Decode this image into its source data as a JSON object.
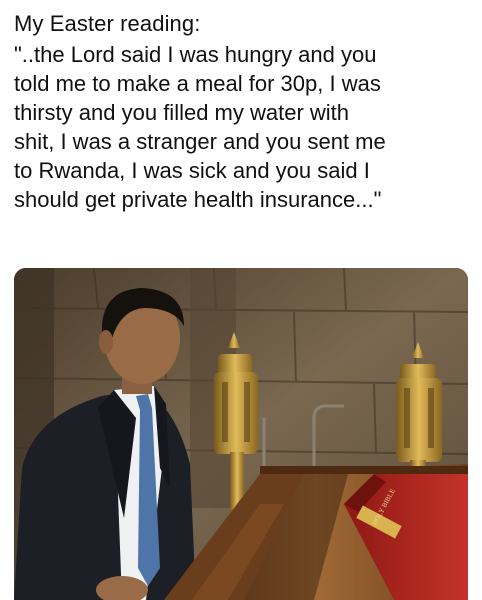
{
  "caption": {
    "title": "My Easter reading:",
    "quote_lines": [
      "\"..the Lord said I was hungry and you",
      "told me to make a meal for 30p, I was",
      "thirsty and you filled my water with",
      "shit, I was a stranger and you sent me",
      "to Rwanda, I was sick and you said I",
      "should get private health insurance...\""
    ]
  },
  "photo": {
    "subject": "man in dark suit speaking at church lectern",
    "book_spine_text": "HOLY BIBLE",
    "colors": {
      "stone_wall": "#6e5c45",
      "wood_lectern": "#8a5a2e",
      "brass": "#c9a046",
      "book_red": "#b3231d",
      "suit": "#1c1f26",
      "tie": "#4f74a8"
    }
  }
}
